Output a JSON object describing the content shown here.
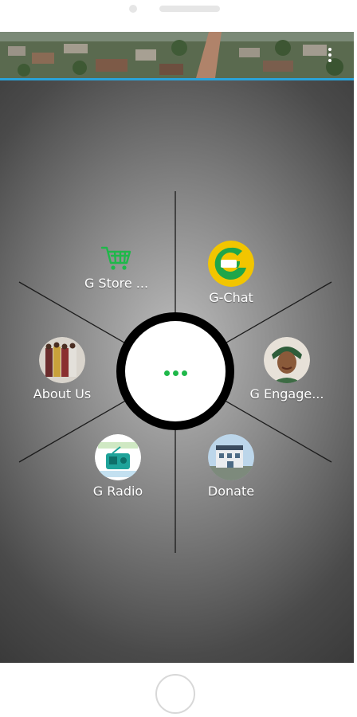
{
  "menu_items": [
    {
      "label": "G Store ...",
      "icon": "cart-icon"
    },
    {
      "label": "G-Chat",
      "icon": "gchat-logo-icon"
    },
    {
      "label": "About Us",
      "icon": "group-photo-icon"
    },
    {
      "label": "G Engage...",
      "icon": "woman-photo-icon"
    },
    {
      "label": "G Radio",
      "icon": "radio-icon"
    },
    {
      "label": "Donate",
      "icon": "building-photo-icon"
    }
  ],
  "colors": {
    "accent_green": "#1fb84a",
    "banner_border": "#2aa3d9",
    "gchat_yellow": "#f2c500"
  }
}
